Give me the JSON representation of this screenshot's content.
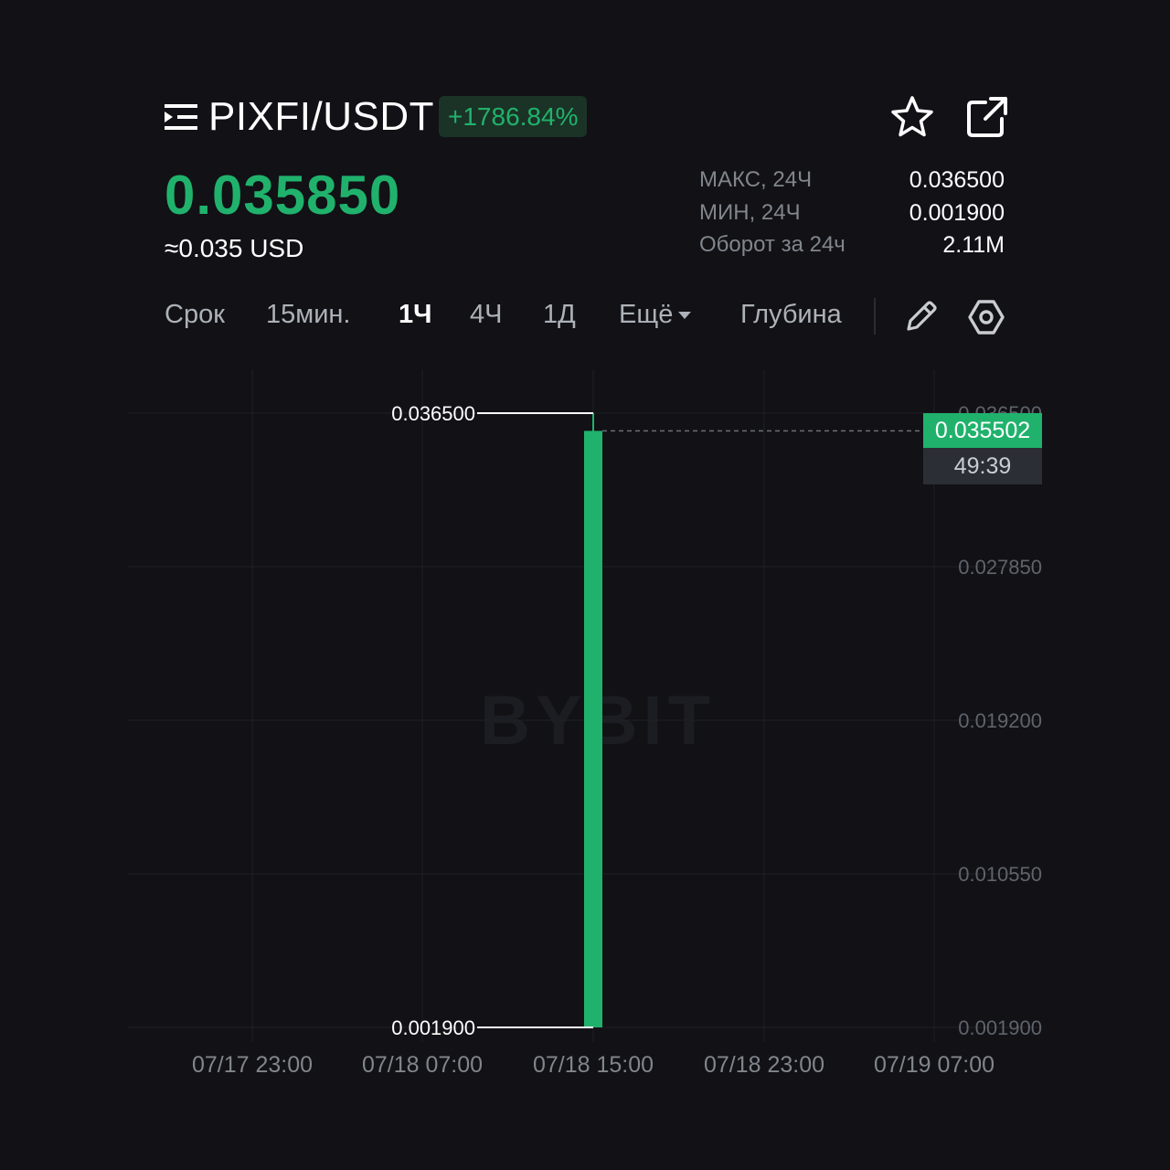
{
  "header": {
    "pair": "PIXFI/USDT",
    "change": "+1786.84%",
    "menu_icon": "menu-lines-icon",
    "star_icon": "star-icon",
    "share_icon": "share-icon"
  },
  "price": {
    "last": "0.035850",
    "usd": "≈0.035 USD"
  },
  "stats": [
    {
      "label": "МАКС, 24Ч",
      "value": "0.036500"
    },
    {
      "label": "МИН, 24Ч",
      "value": "0.001900"
    },
    {
      "label": "Оборот за 24ч",
      "value": "2.11M"
    }
  ],
  "toolbar": {
    "term_label": "Срок",
    "intervals": [
      "15мин.",
      "1Ч",
      "4Ч",
      "1Д"
    ],
    "active_interval": "1Ч",
    "more_label": "Ещё",
    "depth_label": "Глубина",
    "pen_icon": "pencil-icon",
    "settings_icon": "settings-icon"
  },
  "colors": {
    "up": "#20b26c",
    "background": "#111116",
    "grid": "#1f2127"
  },
  "chart_data": {
    "type": "candlestick",
    "x_ticks": [
      "07/17 23:00",
      "07/18 07:00",
      "07/18 15:00",
      "07/18 23:00",
      "07/19 07:00"
    ],
    "y_ticks": [
      "0.036500",
      "0.027850",
      "0.019200",
      "0.010550",
      "0.001900"
    ],
    "ylim": [
      0.0019,
      0.0365
    ],
    "candles": [
      {
        "time": "07/18 15:00",
        "open": 0.0019,
        "high": 0.0365,
        "low": 0.0019,
        "close": 0.035502
      }
    ],
    "high_label": "0.036500",
    "low_label": "0.001900",
    "last_price_label": "0.035502",
    "countdown": "49:39",
    "watermark": "BYBIT",
    "grid": true
  }
}
